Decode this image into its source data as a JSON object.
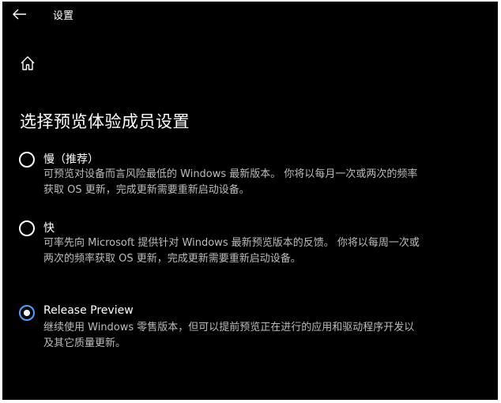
{
  "window": {
    "title": "设置"
  },
  "icons": {
    "back": "back-arrow-icon",
    "home": "home-icon"
  },
  "page": {
    "heading": "选择预览体验成员设置"
  },
  "options": [
    {
      "label": "慢（推荐）",
      "description": "可预览对设备而言风险最低的 Windows 最新版本。 你将以每月一次或两次的频率获取 OS 更新，完成更新需要重新启动设备。",
      "selected": false
    },
    {
      "label": "快",
      "description": "可率先向 Microsoft 提供针对 Windows 最新预览版本的反馈。 你将以每周一次或两次的频率获取 OS 更新，完成更新需要重新启动设备。",
      "selected": false
    },
    {
      "label": "Release Preview",
      "description": "继续使用 Windows 零售版本，但可以提前预览正在进行的应用和驱动程序开发以及其它质量更新。",
      "selected": true
    }
  ],
  "colors": {
    "background": "#000000",
    "accent": "#4aa3ff",
    "text": "#ffffff",
    "secondary_text": "#bcbcbc"
  }
}
